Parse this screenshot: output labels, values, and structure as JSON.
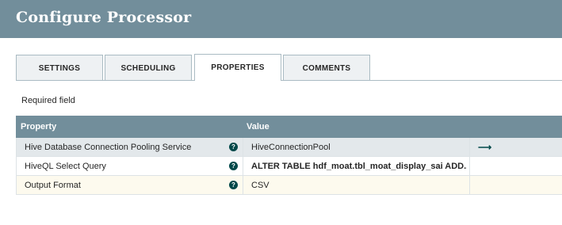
{
  "dialog": {
    "title": "Configure Processor"
  },
  "tabs": [
    {
      "label": "SETTINGS"
    },
    {
      "label": "SCHEDULING"
    },
    {
      "label": "PROPERTIES"
    },
    {
      "label": "COMMENTS"
    }
  ],
  "active_tab": "PROPERTIES",
  "required_label": "Required field",
  "table": {
    "headers": {
      "property": "Property",
      "value": "Value"
    },
    "rows": [
      {
        "property": "Hive Database Connection Pooling Service",
        "value": "HiveConnectionPool",
        "help_icon": "question-circle-icon",
        "action_icon": "arrow-right-icon",
        "action_glyph": "⟶"
      },
      {
        "property": "HiveQL Select Query",
        "value": "ALTER TABLE hdf_moat.tbl_moat_display_sai ADD...",
        "help_icon": "question-circle-icon"
      },
      {
        "property": "Output Format",
        "value": "CSV",
        "help_icon": "question-circle-icon"
      }
    ]
  },
  "colors": {
    "header_bg": "#728e9b",
    "icon": "#004849",
    "selected_row": "#e3e8eb",
    "required_row": "#fdfaee"
  }
}
